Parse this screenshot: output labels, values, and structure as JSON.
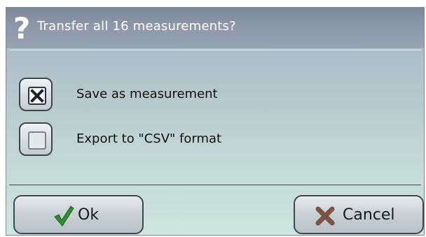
{
  "dialog": {
    "title": "Transfer all 16 measurements?",
    "title_icon": "question-mark-icon"
  },
  "options": [
    {
      "label": "Save as measurement",
      "checked": true,
      "icon": "checked-box-icon"
    },
    {
      "label": "Export to \"CSV\" format",
      "checked": false,
      "icon": "empty-box-icon"
    }
  ],
  "buttons": {
    "ok": {
      "label": "Ok",
      "icon": "checkmark-icon",
      "icon_color": "#2f8f2f"
    },
    "cancel": {
      "label": "Cancel",
      "icon": "x-icon",
      "icon_color": "#7a5445"
    }
  }
}
